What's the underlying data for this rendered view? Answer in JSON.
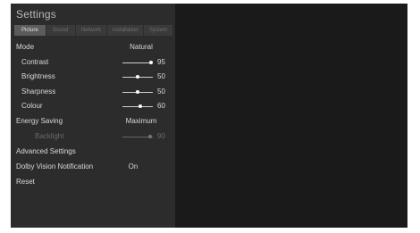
{
  "menu": {
    "title": "Settings",
    "tabs": [
      "Picture",
      "Sound",
      "Network",
      "Installation",
      "System"
    ],
    "active_tab": 0
  },
  "items": {
    "mode": {
      "label": "Mode",
      "value": "Natural"
    },
    "contrast": {
      "label": "Contrast",
      "value": "95",
      "level": 0.95
    },
    "brightness": {
      "label": "Brightness",
      "value": "50",
      "level": 0.5
    },
    "sharpness": {
      "label": "Sharpness",
      "value": "50",
      "level": 0.5
    },
    "colour": {
      "label": "Colour",
      "value": "60",
      "level": 0.6
    },
    "energy_saving": {
      "label": "Energy Saving",
      "value": "Maximum"
    },
    "backlight": {
      "label": "Backlight",
      "value": "90",
      "level": 0.9,
      "disabled": true
    },
    "advanced": {
      "label": "Advanced Settings"
    },
    "dolby": {
      "label": "Dolby Vision Notification",
      "value": "On"
    },
    "reset": {
      "label": "Reset"
    }
  }
}
